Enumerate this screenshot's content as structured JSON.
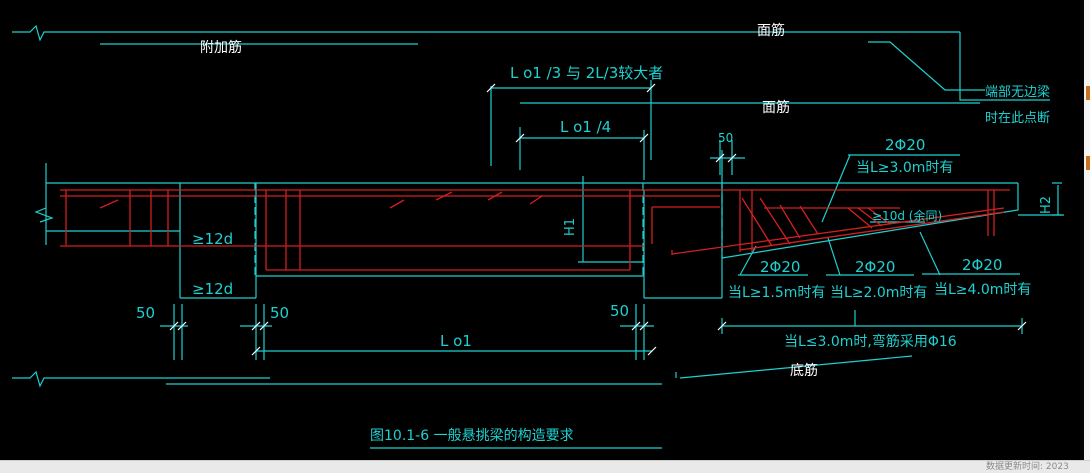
{
  "diagram": {
    "labels": {
      "additional_bar": "附加筋",
      "top_bar_upper": "面筋",
      "top_bar_lower": "面筋",
      "bottom_bar": "底筋",
      "dim_lo1_3": "L o1 /3 与 2L/3较大者",
      "dim_lo1_4": "L o1 /4",
      "dim_50_top": "50",
      "end_note_line1": "端部无边梁",
      "end_note_line2": "时在此点断",
      "bar_2phi20_a": "2Φ20",
      "note_L3": "当L≥3.0m时有",
      "ge_12d_top": "≥12d",
      "ge_12d_bottom": "≥12d",
      "h1": "H1",
      "h2": "H2",
      "ge_10d": "≥10d (余同)",
      "bar_2phi20_b": "2Φ20",
      "note_L15": "当L≥1.5m时有",
      "bar_2phi20_c": "2Φ20",
      "note_L20": "当L≥2.0m时有",
      "bar_2phi20_d": "2Φ20",
      "note_L40": "当L≥4.0m时有",
      "dim_50_left": "50",
      "dim_50_mid": "50",
      "dim_50_right": "50",
      "dim_lo1": "L o1",
      "note_L_le3": "当L≤3.0m时,弯筋采用Φ16",
      "figure_caption": "图10.1-6 一般悬挑梁的构造要求"
    },
    "colors": {
      "background": "#000000",
      "linework": "#1fd0d0",
      "rebar": "#d42020",
      "highlight_text": "#ffffff"
    }
  },
  "status_bar": {
    "text": "数据更新时间: 2023"
  }
}
